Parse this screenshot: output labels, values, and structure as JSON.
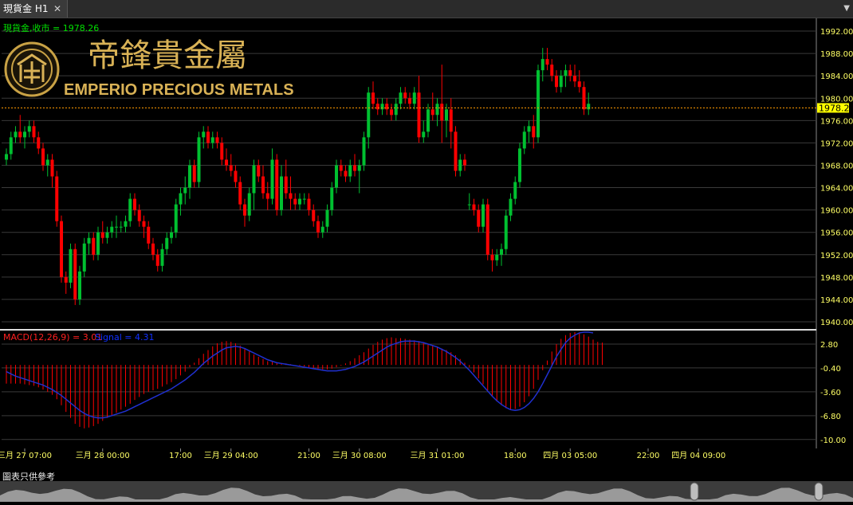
{
  "tab": {
    "label": "現貨金 H1",
    "close_glyph": "✕",
    "menu_glyph": "▼"
  },
  "logo": {
    "chinese": "帝鋒貴金屬",
    "english": "EMPERIO PRECIOUS METALS"
  },
  "disclaimer": "圖表只供參考",
  "colors": {
    "bull": "#00c030",
    "bear": "#ff0000",
    "grid": "#3a3a3a",
    "axis_text": "#ffff66",
    "close_label": "#00e000",
    "macd_label": "#ff2020",
    "signal_label": "#1030ff",
    "signal_line": "#2030d0",
    "current_line": "#ff9900",
    "price_tag_bg": "#ffff00"
  },
  "chart_data": [
    {
      "type": "candlestick",
      "title": "現貨金,收市 = 1978.26",
      "last_price": 1978.26,
      "last_price_label": "1978.26",
      "ylim": [
        1939,
        1994
      ],
      "y_ticks": [
        "1992.00",
        "1988.00",
        "1984.00",
        "1980.00",
        "1976.00",
        "1972.00",
        "1968.00",
        "1964.00",
        "1960.00",
        "1956.00",
        "1952.00",
        "1948.00",
        "1944.00",
        "1940.00"
      ],
      "y_tick_values": [
        1992,
        1988,
        1984,
        1980,
        1976,
        1972,
        1968,
        1964,
        1960,
        1956,
        1952,
        1948,
        1944,
        1940
      ],
      "x_labels": [
        {
          "text": "三月 27 07:00",
          "index": 4
        },
        {
          "text": "三月 28 00:00",
          "index": 21
        },
        {
          "text": "17:00",
          "index": 38
        },
        {
          "text": "三月 29 04:00",
          "index": 49
        },
        {
          "text": "21:00",
          "index": 66
        },
        {
          "text": "三月 30 08:00",
          "index": 77
        },
        {
          "text": "三月 31 01:00",
          "index": 94
        },
        {
          "text": "18:00",
          "index": 111
        },
        {
          "text": "四月 03 05:00",
          "index": 123
        },
        {
          "text": "22:00",
          "index": 140
        },
        {
          "text": "四月 04 09:00",
          "index": 151
        }
      ],
      "candles": [
        [
          1969,
          1971,
          1968,
          1970
        ],
        [
          1970,
          1974,
          1969,
          1973
        ],
        [
          1973,
          1975,
          1972,
          1974
        ],
        [
          1974,
          1977,
          1972,
          1973
        ],
        [
          1973,
          1975,
          1971,
          1974
        ],
        [
          1974,
          1976,
          1973,
          1975
        ],
        [
          1975,
          1976,
          1972,
          1973
        ],
        [
          1973,
          1974,
          1970,
          1971
        ],
        [
          1971,
          1972,
          1967,
          1968
        ],
        [
          1968,
          1970,
          1966,
          1969
        ],
        [
          1969,
          1970,
          1964,
          1966
        ],
        [
          1966,
          1967,
          1957,
          1958
        ],
        [
          1958,
          1959,
          1947,
          1948
        ],
        [
          1948,
          1949,
          1945,
          1947
        ],
        [
          1947,
          1954,
          1946,
          1953
        ],
        [
          1953,
          1954,
          1943,
          1944
        ],
        [
          1944,
          1950,
          1943,
          1949
        ],
        [
          1949,
          1955,
          1948,
          1954
        ],
        [
          1954,
          1956,
          1952,
          1955
        ],
        [
          1955,
          1956,
          1951,
          1952
        ],
        [
          1952,
          1957,
          1951,
          1956
        ],
        [
          1956,
          1958,
          1954,
          1955
        ],
        [
          1955,
          1957,
          1954,
          1956
        ],
        [
          1956,
          1958,
          1955,
          1957
        ],
        [
          1957,
          1959,
          1955,
          1957
        ],
        [
          1957,
          1958,
          1956,
          1957
        ],
        [
          1957,
          1959,
          1956,
          1958
        ],
        [
          1958,
          1963,
          1957,
          1962
        ],
        [
          1962,
          1963,
          1959,
          1960
        ],
        [
          1960,
          1961,
          1957,
          1958
        ],
        [
          1958,
          1959,
          1955,
          1957
        ],
        [
          1957,
          1958,
          1953,
          1954
        ],
        [
          1954,
          1955,
          1951,
          1952
        ],
        [
          1952,
          1953,
          1949,
          1950
        ],
        [
          1950,
          1954,
          1949,
          1953
        ],
        [
          1953,
          1956,
          1952,
          1955
        ],
        [
          1955,
          1957,
          1954,
          1956
        ],
        [
          1956,
          1962,
          1955,
          1961
        ],
        [
          1961,
          1964,
          1959,
          1963
        ],
        [
          1963,
          1966,
          1961,
          1964
        ],
        [
          1964,
          1969,
          1962,
          1968
        ],
        [
          1968,
          1969,
          1964,
          1965
        ],
        [
          1965,
          1974,
          1964,
          1973
        ],
        [
          1973,
          1975,
          1971,
          1974
        ],
        [
          1974,
          1975,
          1971,
          1972
        ],
        [
          1972,
          1974,
          1971,
          1973
        ],
        [
          1973,
          1974,
          1971,
          1972
        ],
        [
          1972,
          1973,
          1968,
          1969
        ],
        [
          1969,
          1971,
          1967,
          1968
        ],
        [
          1968,
          1970,
          1966,
          1967
        ],
        [
          1967,
          1968,
          1964,
          1965
        ],
        [
          1965,
          1966,
          1960,
          1961
        ],
        [
          1961,
          1962,
          1957,
          1959
        ],
        [
          1959,
          1964,
          1958,
          1963
        ],
        [
          1963,
          1969,
          1960,
          1968
        ],
        [
          1968,
          1969,
          1965,
          1966
        ],
        [
          1966,
          1968,
          1962,
          1963
        ],
        [
          1963,
          1965,
          1960,
          1962
        ],
        [
          1962,
          1971,
          1961,
          1969
        ],
        [
          1969,
          1970,
          1959,
          1960
        ],
        [
          1960,
          1968,
          1959,
          1966
        ],
        [
          1966,
          1969,
          1962,
          1963
        ],
        [
          1963,
          1966,
          1960,
          1962
        ],
        [
          1962,
          1963,
          1960,
          1961
        ],
        [
          1961,
          1963,
          1960,
          1962
        ],
        [
          1962,
          1963,
          1961,
          1962
        ],
        [
          1962,
          1963,
          1959,
          1960
        ],
        [
          1960,
          1961,
          1957,
          1958
        ],
        [
          1958,
          1959,
          1955,
          1956
        ],
        [
          1956,
          1958,
          1955,
          1957
        ],
        [
          1957,
          1961,
          1956,
          1960
        ],
        [
          1960,
          1965,
          1959,
          1964
        ],
        [
          1964,
          1969,
          1963,
          1968
        ],
        [
          1968,
          1969,
          1966,
          1967
        ],
        [
          1967,
          1968,
          1965,
          1966
        ],
        [
          1966,
          1969,
          1965,
          1968
        ],
        [
          1968,
          1970,
          1966,
          1967
        ],
        [
          1967,
          1969,
          1963,
          1968
        ],
        [
          1968,
          1974,
          1967,
          1973
        ],
        [
          1973,
          1982,
          1971,
          1981
        ],
        [
          1981,
          1983,
          1978,
          1979
        ],
        [
          1979,
          1980,
          1977,
          1978
        ],
        [
          1978,
          1980,
          1977,
          1979
        ],
        [
          1979,
          1980,
          1977,
          1978
        ],
        [
          1978,
          1979,
          1976,
          1977
        ],
        [
          1977,
          1980,
          1976,
          1979
        ],
        [
          1979,
          1982,
          1978,
          1981
        ],
        [
          1981,
          1982,
          1979,
          1980
        ],
        [
          1980,
          1981,
          1978,
          1979
        ],
        [
          1979,
          1982,
          1978,
          1981
        ],
        [
          1981,
          1984,
          1972,
          1973
        ],
        [
          1973,
          1976,
          1972,
          1974
        ],
        [
          1974,
          1979,
          1973,
          1978
        ],
        [
          1978,
          1981,
          1976,
          1977
        ],
        [
          1977,
          1980,
          1975,
          1979
        ],
        [
          1979,
          1986,
          1972,
          1976
        ],
        [
          1976,
          1979,
          1973,
          1978
        ],
        [
          1978,
          1980,
          1971,
          1974
        ],
        [
          1974,
          1975,
          1966,
          1967
        ],
        [
          1967,
          1970,
          1966,
          1969
        ],
        [
          1969,
          1970,
          1967,
          1968
        ],
        [
          1961,
          1963,
          1960,
          1961
        ],
        [
          1961,
          1962,
          1959,
          1960
        ],
        [
          1960,
          1961,
          1956,
          1957
        ],
        [
          1957,
          1962,
          1956,
          1961
        ],
        [
          1961,
          1962,
          1951,
          1952
        ],
        [
          1952,
          1953,
          1949,
          1951
        ],
        [
          1951,
          1953,
          1950,
          1952
        ],
        [
          1952,
          1954,
          1950,
          1953
        ],
        [
          1953,
          1960,
          1952,
          1959
        ],
        [
          1959,
          1963,
          1958,
          1962
        ],
        [
          1962,
          1966,
          1961,
          1965
        ],
        [
          1965,
          1972,
          1964,
          1971
        ],
        [
          1971,
          1975,
          1970,
          1974
        ],
        [
          1974,
          1976,
          1972,
          1975
        ],
        [
          1975,
          1977,
          1971,
          1973
        ],
        [
          1973,
          1986,
          1972,
          1985
        ],
        [
          1985,
          1989,
          1983,
          1987
        ],
        [
          1987,
          1989,
          1985,
          1986
        ],
        [
          1986,
          1987,
          1983,
          1984
        ],
        [
          1984,
          1985,
          1981,
          1982
        ],
        [
          1982,
          1985,
          1981,
          1984
        ],
        [
          1984,
          1986,
          1982,
          1985
        ],
        [
          1985,
          1986,
          1983,
          1984
        ],
        [
          1984,
          1986,
          1982,
          1983
        ],
        [
          1983,
          1985,
          1981,
          1982
        ],
        [
          1982,
          1983,
          1977,
          1978
        ],
        [
          1978,
          1981,
          1977,
          1979
        ]
      ],
      "candle_slots": [
        0,
        1,
        2,
        3,
        4,
        5,
        6,
        7,
        8,
        9,
        10,
        11,
        12,
        13,
        14,
        15,
        16,
        17,
        18,
        19,
        20,
        21,
        22,
        23,
        24,
        25,
        26,
        27,
        28,
        29,
        30,
        31,
        32,
        33,
        34,
        35,
        36,
        37,
        38,
        39,
        40,
        41,
        42,
        43,
        44,
        45,
        46,
        47,
        48,
        49,
        50,
        51,
        52,
        53,
        54,
        55,
        56,
        57,
        58,
        59,
        60,
        61,
        62,
        63,
        64,
        65,
        66,
        67,
        68,
        69,
        70,
        71,
        72,
        73,
        74,
        75,
        76,
        77,
        78,
        79,
        80,
        81,
        82,
        83,
        84,
        85,
        86,
        87,
        88,
        89,
        90,
        91,
        92,
        93,
        94,
        95,
        96,
        97,
        98,
        99,
        100,
        101,
        102,
        103,
        104,
        105,
        106,
        107,
        108,
        109,
        110,
        111,
        112,
        113,
        114,
        115,
        116,
        117,
        118,
        119,
        120,
        121,
        122,
        123,
        124,
        125,
        126,
        127,
        128,
        129,
        130,
        131,
        132,
        133,
        134,
        135,
        136,
        137,
        138,
        139,
        140,
        141
      ]
    },
    {
      "type": "macd",
      "macd_label": "MACD(12,26,9) = 3.01",
      "signal_label": "Signal = 4.31",
      "macd_value": 3.01,
      "signal_value": 4.31,
      "ylim": [
        -11.2,
        4.4
      ],
      "y_ticks": [
        "2.80",
        "-0.40",
        "-3.60",
        "-6.80",
        "-10.00"
      ],
      "y_tick_values": [
        2.8,
        -0.4,
        -3.6,
        -6.8,
        -10.0
      ],
      "histogram": [
        -2.5,
        -2.5,
        -2.5,
        -2.5,
        -2.6,
        -2.7,
        -2.8,
        -3.0,
        -3.3,
        -3.6,
        -4.0,
        -4.6,
        -5.4,
        -6.3,
        -7.1,
        -7.9,
        -8.3,
        -8.5,
        -8.4,
        -8.2,
        -7.9,
        -7.5,
        -7.1,
        -6.8,
        -6.4,
        -6.0,
        -5.6,
        -5.2,
        -4.7,
        -4.3,
        -3.9,
        -3.6,
        -3.4,
        -3.2,
        -2.9,
        -2.6,
        -2.3,
        -1.9,
        -1.4,
        -0.9,
        -0.3,
        0.3,
        0.9,
        1.5,
        2.0,
        2.5,
        2.9,
        3.1,
        3.2,
        3.1,
        2.9,
        2.6,
        2.2,
        1.8,
        1.4,
        1.1,
        0.8,
        0.5,
        0.4,
        0.3,
        0.2,
        0.2,
        0.1,
        0.0,
        -0.1,
        -0.2,
        -0.3,
        -0.4,
        -0.5,
        -0.6,
        -0.6,
        -0.5,
        -0.3,
        -0.1,
        0.2,
        0.5,
        0.9,
        1.3,
        1.7,
        2.2,
        2.7,
        3.1,
        3.4,
        3.6,
        3.7,
        3.6,
        3.6,
        3.5,
        3.4,
        3.3,
        3.2,
        3.0,
        2.8,
        2.6,
        2.4,
        2.2,
        2.0,
        1.7,
        1.3,
        0.8,
        0.3,
        -0.3,
        -1.0,
        -1.8,
        -2.6,
        -3.4,
        -4.2,
        -4.9,
        -5.4,
        -5.8,
        -6.0,
        -5.9,
        -5.6,
        -5.0,
        -4.2,
        -3.2,
        -2.0,
        -0.7,
        0.6,
        1.8,
        2.8,
        3.5,
        4.0,
        4.3,
        4.4,
        4.3,
        4.1,
        3.8,
        3.4,
        3.1,
        3.0
      ],
      "signal": [
        -0.9,
        -1.2,
        -1.5,
        -1.7,
        -1.9,
        -2.1,
        -2.3,
        -2.5,
        -2.7,
        -3.0,
        -3.3,
        -3.7,
        -4.1,
        -4.6,
        -5.1,
        -5.6,
        -6.1,
        -6.5,
        -6.8,
        -7.0,
        -7.1,
        -7.1,
        -7.0,
        -6.8,
        -6.6,
        -6.4,
        -6.2,
        -5.9,
        -5.6,
        -5.3,
        -5.0,
        -4.7,
        -4.4,
        -4.1,
        -3.8,
        -3.5,
        -3.2,
        -2.8,
        -2.4,
        -2.0,
        -1.5,
        -1.0,
        -0.4,
        0.2,
        0.7,
        1.2,
        1.6,
        2.0,
        2.3,
        2.4,
        2.5,
        2.4,
        2.2,
        1.9,
        1.6,
        1.3,
        1.0,
        0.7,
        0.5,
        0.3,
        0.2,
        0.1,
        0.0,
        -0.1,
        -0.2,
        -0.3,
        -0.4,
        -0.5,
        -0.6,
        -0.7,
        -0.8,
        -0.8,
        -0.8,
        -0.7,
        -0.6,
        -0.4,
        -0.2,
        0.1,
        0.4,
        0.8,
        1.2,
        1.6,
        2.0,
        2.4,
        2.7,
        2.9,
        3.1,
        3.2,
        3.2,
        3.2,
        3.1,
        3.0,
        2.8,
        2.6,
        2.4,
        2.1,
        1.8,
        1.4,
        1.0,
        0.5,
        -0.1,
        -0.7,
        -1.4,
        -2.1,
        -2.8,
        -3.5,
        -4.2,
        -4.8,
        -5.3,
        -5.7,
        -6.0,
        -6.1,
        -6.0,
        -5.7,
        -5.2,
        -4.5,
        -3.6,
        -2.5,
        -1.3,
        -0.1,
        1.1,
        2.1,
        3.0,
        3.6,
        4.0,
        4.3,
        4.4,
        4.4,
        4.3
      ]
    }
  ]
}
